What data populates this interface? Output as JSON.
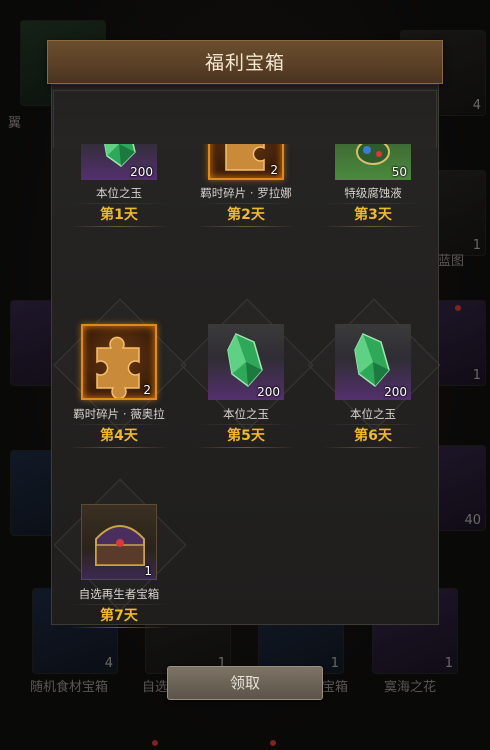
{
  "dialog": {
    "title": "福利宝箱",
    "claim_label": "领取"
  },
  "rewards": [
    {
      "name": "本位之玉",
      "count": "200",
      "day": "第1天",
      "rarity": "purple",
      "icon": "green-crystal-icon"
    },
    {
      "name": "羁时碎片 · 罗拉娜",
      "count": "2",
      "day": "第2天",
      "rarity": "orange",
      "icon": "puzzle-piece-icon"
    },
    {
      "name": "特级腐蚀液",
      "count": "50",
      "day": "第3天",
      "rarity": "green",
      "icon": "potion-icon"
    },
    {
      "name": "羁时碎片 · 薇奥拉",
      "count": "2",
      "day": "第4天",
      "rarity": "orange",
      "icon": "puzzle-piece-icon"
    },
    {
      "name": "本位之玉",
      "count": "200",
      "day": "第5天",
      "rarity": "purple",
      "icon": "green-crystal-icon"
    },
    {
      "name": "本位之玉",
      "count": "200",
      "day": "第6天",
      "rarity": "purple",
      "icon": "green-crystal-icon"
    },
    {
      "name": "自选再生者宝箱",
      "count": "1",
      "day": "第7天",
      "rarity": "chest",
      "icon": "treasure-chest-icon"
    }
  ],
  "background": {
    "labels": [
      "翼",
      "随机食材宝箱",
      "自选",
      "宝箱",
      "寞海之花",
      "蓝图"
    ],
    "counts": [
      "4",
      "1",
      "1",
      "1",
      "1",
      "40",
      "4",
      "1",
      "1",
      "1"
    ]
  },
  "colors": {
    "day_text": "#f0b92a",
    "header": "#5a4026",
    "panel": "#262524",
    "rarity_purple": "#54306e",
    "rarity_orange": "#e08a1a",
    "rarity_green": "#4b8a3c"
  }
}
